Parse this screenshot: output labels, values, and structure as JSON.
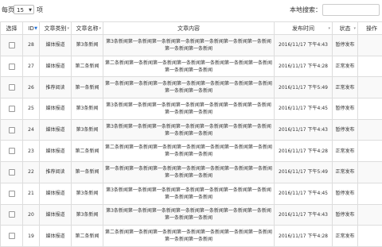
{
  "toolbar": {
    "per_page_label": "每页",
    "page_size": "15",
    "items_suffix": "项",
    "search_label": "本地搜索：",
    "search_value": ""
  },
  "table": {
    "headers": [
      "选择",
      "ID",
      "文章类别",
      "文章名称",
      "文章内容",
      "发布时间",
      "状态",
      "操作"
    ],
    "rows": [
      {
        "id": "28",
        "cat": "媒体报道",
        "name": "第3条新闻",
        "content": "第3条新闻第一条新闻第一条新闻第一条新闻第一条新闻第一条新闻第一条新闻第一条新闻第一条新闻",
        "time": "2016/11/17 下午4:43",
        "status": "暂停发布"
      },
      {
        "id": "27",
        "cat": "媒体报道",
        "name": "第二条新闻",
        "content": "第二条新闻第一条新闻第一条新闻第一条新闻第一条新闻第一条新闻第一条新闻第一条新闻第一条新闻",
        "time": "2016/11/17 下午4:28",
        "status": "正常发布"
      },
      {
        "id": "26",
        "cat": "推荐阅读",
        "name": "第一条新闻",
        "content": "第一条新闻第一条新闻第一条新闻第一条新闻第一条新闻第一条新闻第一条新闻第一条新闻第一条新闻",
        "time": "2016/11/17 下午5:49",
        "status": "正常发布"
      },
      {
        "id": "25",
        "cat": "媒体报道",
        "name": "第3条新闻",
        "content": "第3条新闻第一条新闻第一条新闻第一条新闻第一条新闻第一条新闻第一条新闻第一条新闻第一条新闻",
        "time": "2016/11/17 下午4:45",
        "status": "暂停发布"
      },
      {
        "id": "24",
        "cat": "媒体报道",
        "name": "第3条新闻",
        "content": "第3条新闻第一条新闻第一条新闻第一条新闻第一条新闻第一条新闻第一条新闻第一条新闻第一条新闻",
        "time": "2016/11/17 下午4:43",
        "status": "暂停发布"
      },
      {
        "id": "23",
        "cat": "媒体报道",
        "name": "第二条新闻",
        "content": "第二条新闻第一条新闻第一条新闻第一条新闻第一条新闻第一条新闻第一条新闻第一条新闻第一条新闻",
        "time": "2016/11/17 下午4:28",
        "status": "正常发布"
      },
      {
        "id": "22",
        "cat": "推荐阅读",
        "name": "第一条新闻",
        "content": "第一条新闻第一条新闻第一条新闻第一条新闻第一条新闻第一条新闻第一条新闻第一条新闻第一条新闻",
        "time": "2016/11/17 下午5:49",
        "status": "正常发布"
      },
      {
        "id": "21",
        "cat": "媒体报道",
        "name": "第3条新闻",
        "content": "第3条新闻第一条新闻第一条新闻第一条新闻第一条新闻第一条新闻第一条新闻第一条新闻第一条新闻",
        "time": "2016/11/17 下午4:45",
        "status": "暂停发布"
      },
      {
        "id": "20",
        "cat": "媒体报道",
        "name": "第3条新闻",
        "content": "第3条新闻第一条新闻第一条新闻第一条新闻第一条新闻第一条新闻第一条新闻第一条新闻第一条新闻",
        "time": "2016/11/17 下午4:43",
        "status": "暂停发布"
      },
      {
        "id": "19",
        "cat": "媒体报道",
        "name": "第二条新闻",
        "content": "第二条新闻第一条新闻第一条新闻第一条新闻第一条新闻第一条新闻第一条新闻第一条新闻第一条新闻",
        "time": "2016/11/17 下午4:28",
        "status": "正常发布"
      }
    ]
  }
}
